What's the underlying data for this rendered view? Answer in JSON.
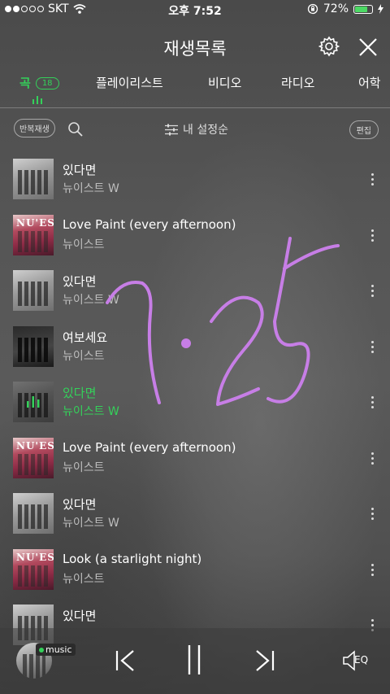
{
  "status": {
    "carrier": "SKT",
    "time": "오후 7:52",
    "battery": "72%"
  },
  "header": {
    "title": "재생목록"
  },
  "tabs": [
    {
      "label": "곡",
      "badge": "18",
      "active": true
    },
    {
      "label": "플레이리스트"
    },
    {
      "label": "비디오"
    },
    {
      "label": "라디오"
    },
    {
      "label": "어학"
    }
  ],
  "toolbar": {
    "repeat_label": "반복재생",
    "sort_label": "내 설정순",
    "edit_label": "편집"
  },
  "songs": [
    {
      "title": "있다면",
      "artist": "뉴이스트 W"
    },
    {
      "title": "Love Paint (every afternoon)",
      "artist": "뉴이스트"
    },
    {
      "title": "있다면",
      "artist": "뉴이스트 W"
    },
    {
      "title": "여보세요",
      "artist": "뉴이스트"
    },
    {
      "title": "있다면",
      "artist": "뉴이스트 W",
      "playing": true
    },
    {
      "title": "Love Paint (every afternoon)",
      "artist": "뉴이스트"
    },
    {
      "title": "있다면",
      "artist": "뉴이스트 W"
    },
    {
      "title": "Look (a starlight night)",
      "artist": "뉴이스트"
    },
    {
      "title": "있다면",
      "artist": ""
    }
  ],
  "album_art_text": "NU'EST",
  "player": {
    "badge": "music",
    "eq_label": "EQ"
  },
  "colors": {
    "accent": "#34d15a",
    "scribble": "#c77ee6"
  }
}
